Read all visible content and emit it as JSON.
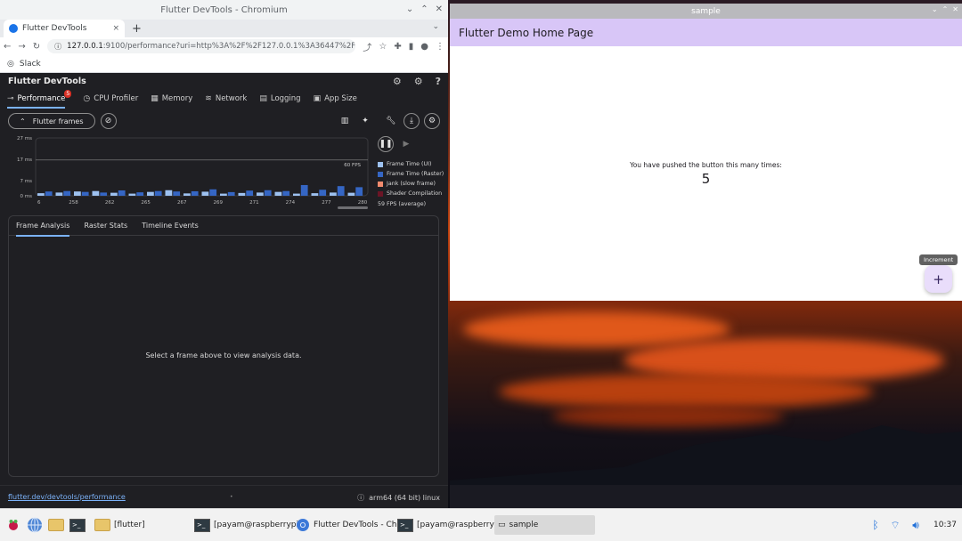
{
  "chrome": {
    "window_title": "Flutter DevTools - Chromium",
    "tab_title": "Flutter DevTools",
    "tab_close": "×",
    "new_tab": "+",
    "url_host": "127.0.0.1",
    "url_rest": ":9100/performance?uri=http%3A%2F%2F127.0.0.1%3A36447%2Fj1L4lYQf-M...",
    "bookmark": "Slack"
  },
  "devtools": {
    "title": "Flutter DevTools",
    "tabs": [
      {
        "label": "Performance",
        "badge": "5"
      },
      {
        "label": "CPU Profiler"
      },
      {
        "label": "Memory"
      },
      {
        "label": "Network"
      },
      {
        "label": "Logging"
      },
      {
        "label": "App Size"
      }
    ],
    "flutter_frames_label": "Flutter frames",
    "analysis_tabs": [
      "Frame Analysis",
      "Raster Stats",
      "Timeline Events"
    ],
    "analysis_empty": "Select a frame above to view analysis data.",
    "footer_link": "flutter.dev/devtools/performance",
    "footer_platform": "arm64 (64 bit) linux"
  },
  "chart_data": {
    "type": "bar",
    "y_ticks": [
      "27 ms",
      "17 ms",
      "7 ms",
      "0 ms"
    ],
    "x_ticks": [
      "6",
      "258",
      "262",
      "265",
      "267",
      "269",
      "271",
      "274",
      "277",
      "280"
    ],
    "fps_line_label": "60 FPS",
    "fps_average": "59 FPS (average)",
    "ylim": [
      0,
      27
    ],
    "series": [
      {
        "name": "Frame Time (UI)",
        "color": "#9dc1f0",
        "values": [
          1.2,
          1.5,
          2.0,
          2.2,
          1.4,
          1.0,
          1.8,
          2.6,
          1.1,
          1.9,
          1.0,
          1.3,
          1.5,
          1.8,
          1.0,
          1.2,
          1.5,
          1.4
        ]
      },
      {
        "name": "Frame Time (Raster)",
        "color": "#3566c4",
        "values": [
          2.0,
          2.2,
          1.8,
          1.5,
          2.5,
          1.6,
          2.2,
          2.0,
          2.1,
          3.0,
          1.7,
          2.4,
          2.6,
          2.2,
          5.0,
          2.8,
          4.5,
          4.0
        ]
      },
      {
        "name": "Jank (slow frame)",
        "color": "#f28b6e",
        "values": []
      },
      {
        "name": "Shader Compilation",
        "color": "#6b1526",
        "values": []
      }
    ]
  },
  "sample_app": {
    "window_title": "sample",
    "app_bar_title": "Flutter Demo Home Page",
    "caption": "You have pushed the button this many times:",
    "counter": "5",
    "tooltip": "Increment",
    "fab_label": "+"
  },
  "taskbar": {
    "items": [
      {
        "label": "[flutter]"
      },
      {
        "label": "[payam@raspberrypi..."
      },
      {
        "label": "Flutter DevTools - Ch..."
      },
      {
        "label": "[payam@raspberrypi..."
      },
      {
        "label": "sample"
      }
    ],
    "clock": "10:37"
  }
}
